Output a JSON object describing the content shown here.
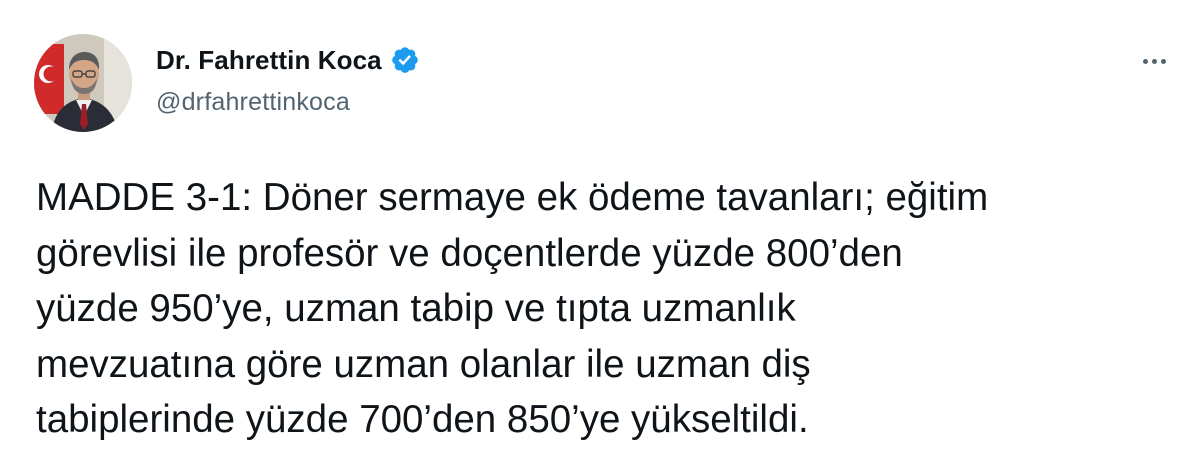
{
  "author": {
    "display_name": "Dr. Fahrettin Koca",
    "handle": "@drfahrettinkoca",
    "verified": true,
    "avatar": "profile-photo",
    "verified_icon": "verified-badge-icon",
    "verified_color": "#1d9bf0"
  },
  "menu": {
    "icon": "more-options-icon"
  },
  "tweet": {
    "lines": [
      "MADDE 3-1: Döner sermaye ek ödeme tavanları; eğitim",
      "görevlisi ile profesör ve doçentlerde yüzde 800’den",
      "yüzde 950’ye, uzman tabip ve tıpta uzmanlık",
      "mevzuatına göre uzman olanlar ile uzman diş",
      "tabiplerinde yüzde 700’den 850’ye yükseltildi."
    ]
  },
  "colors": {
    "text": "#0f1419",
    "secondary_text": "#536471",
    "background": "#ffffff"
  }
}
